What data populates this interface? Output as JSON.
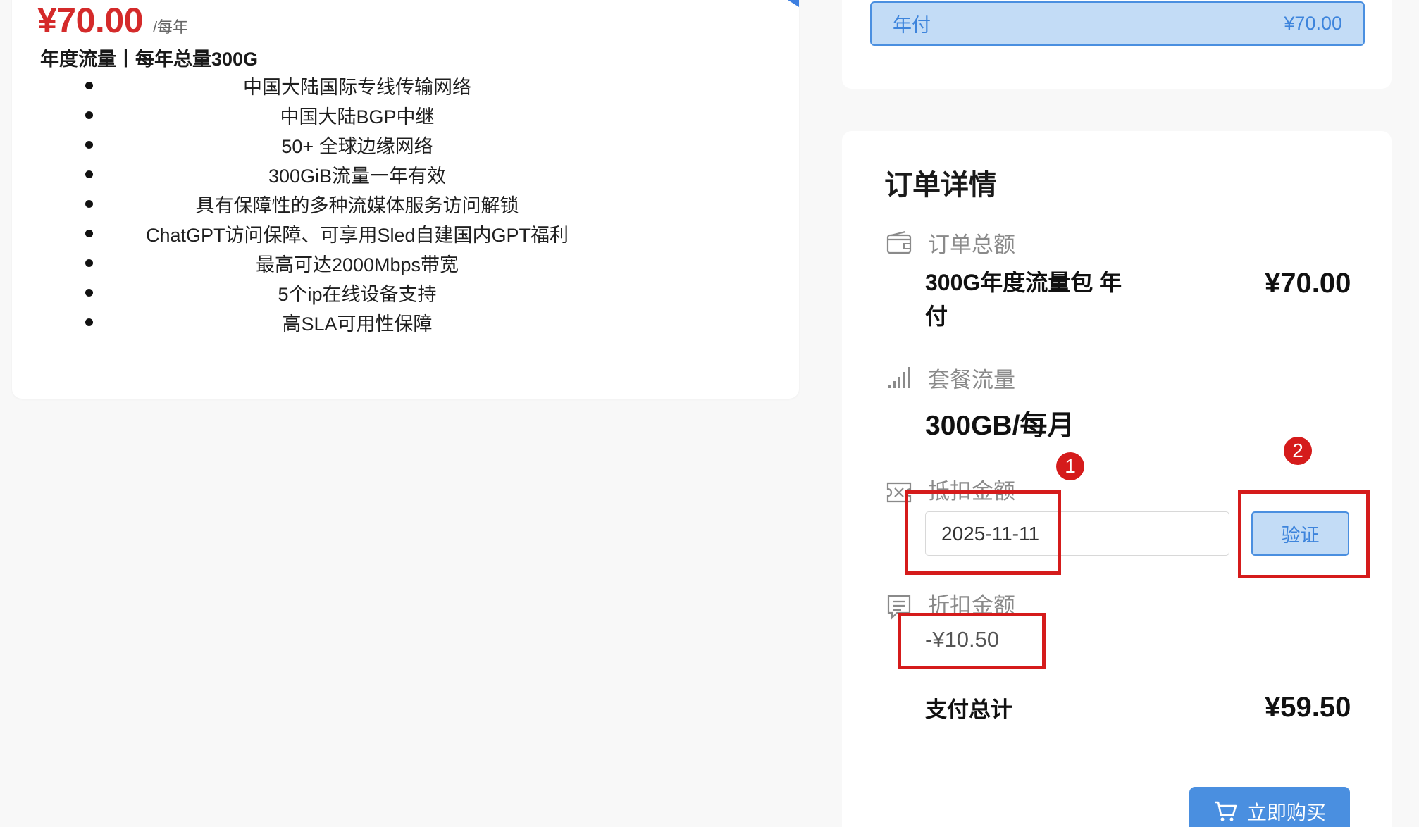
{
  "plan": {
    "price": "¥70.00",
    "period": "/每年",
    "subtitle": "年度流量丨每年总量300G",
    "features": [
      "中国大陆国际专线传输网络",
      "中国大陆BGP中继",
      "50+ 全球边缘网络",
      "300GiB流量一年有效",
      "具有保障性的多种流媒体服务访问解锁",
      "ChatGPT访问保障、可享用Sled自建国内GPT福利",
      "最高可达2000Mbps带宽",
      "5个ip在线设备支持",
      "高SLA可用性保障"
    ]
  },
  "billing": {
    "option_label": "年付",
    "option_price": "¥70.00"
  },
  "order": {
    "title": "订单详情",
    "total_label": "订单总额",
    "product_name_line1": "300G年度流量包 年",
    "product_name_line2": "付",
    "product_price": "¥70.00",
    "traffic_label": "套餐流量",
    "traffic_value": "300GB/每月",
    "coupon_label": "抵扣金额",
    "coupon_input_value": "2025-11-11",
    "verify_label": "验证",
    "discount_label": "折扣金额",
    "discount_value": "-¥10.50",
    "pay_total_label": "支付总计",
    "pay_total_value": "¥59.50",
    "buy_label": "立即购买"
  },
  "annotations": {
    "badge_1": "1",
    "badge_2": "2",
    "color": "#d51b1b"
  },
  "colors": {
    "price_red": "#d42a2a",
    "accent_blue": "#4a8fe0",
    "accent_light": "#c3dcf6"
  }
}
